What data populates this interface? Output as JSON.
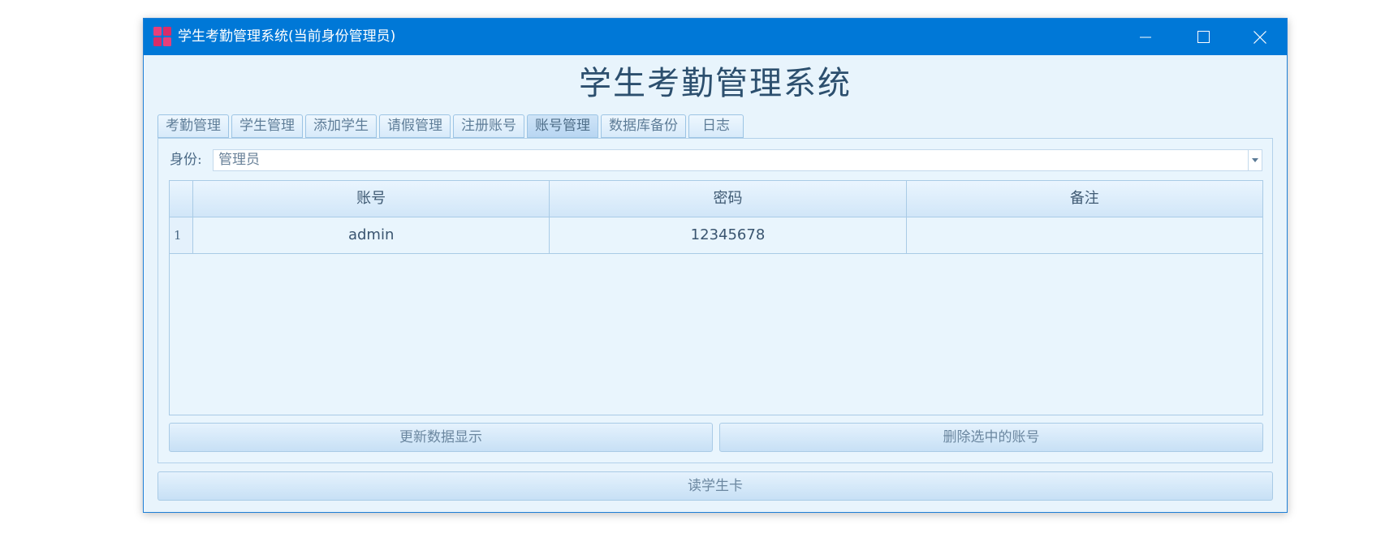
{
  "window": {
    "title": "学生考勤管理系统(当前身份管理员)",
    "accent_color": "#0078d7",
    "icons": {
      "app": "app-logo-icon",
      "minimize": "minimize-icon",
      "maximize": "maximize-icon",
      "close": "close-icon"
    }
  },
  "header": {
    "title": "学生考勤管理系统"
  },
  "tabs": [
    {
      "label": "考勤管理"
    },
    {
      "label": "学生管理"
    },
    {
      "label": "添加学生"
    },
    {
      "label": "请假管理"
    },
    {
      "label": "注册账号"
    },
    {
      "label": "账号管理",
      "active": true
    },
    {
      "label": "数据库备份"
    },
    {
      "label": "日志"
    }
  ],
  "account_panel": {
    "role_label": "身份:",
    "role_value": "管理员",
    "table": {
      "columns": [
        "账号",
        "密码",
        "备注"
      ],
      "rows": [
        {
          "index": "1",
          "cells": [
            "admin",
            "12345678",
            ""
          ]
        }
      ]
    },
    "refresh_button": "更新数据显示",
    "delete_button": "删除选中的账号"
  },
  "footer": {
    "read_card_button": "读学生卡"
  }
}
